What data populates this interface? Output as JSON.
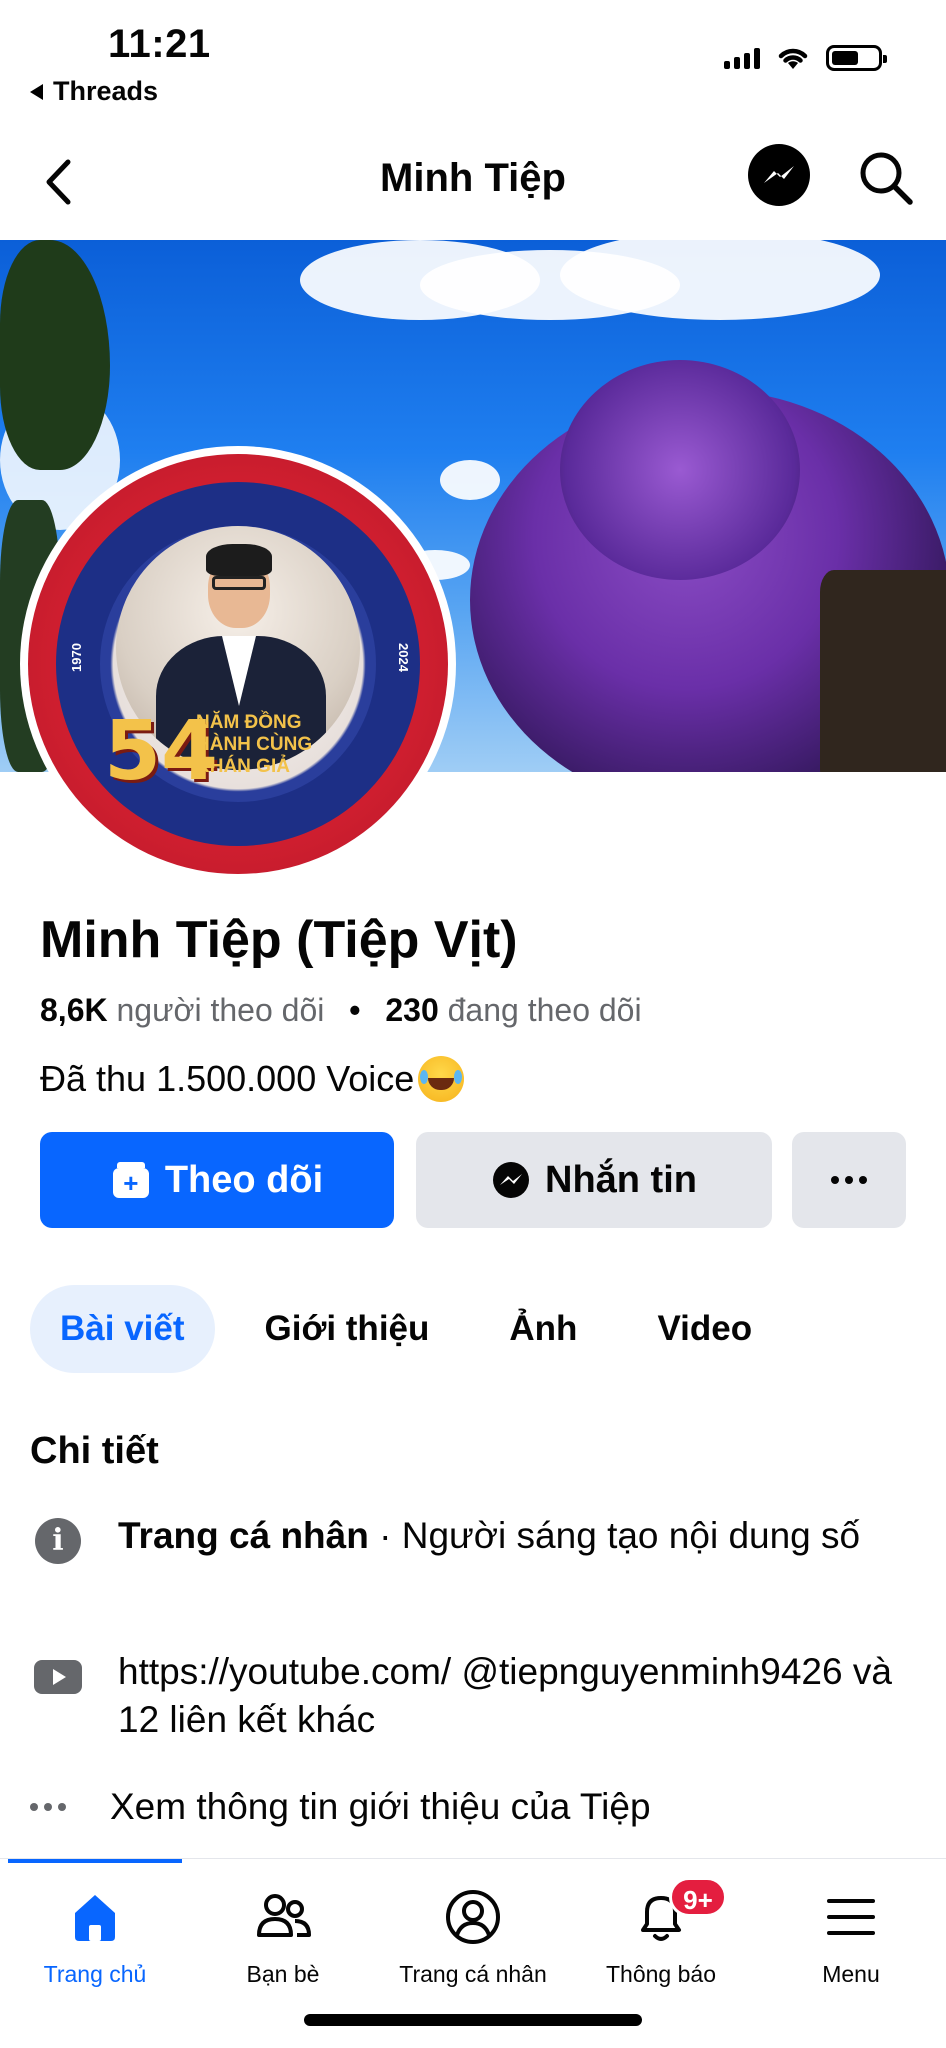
{
  "status_bar": {
    "time": "11:21",
    "back_app": "Threads"
  },
  "header": {
    "title": "Minh Tiệp"
  },
  "avatar": {
    "badge_number": "54",
    "badge_text": "NĂM ĐỒNG HÀNH CÙNG KHÁN GIẢ",
    "year_start": "1970",
    "year_end": "2024"
  },
  "profile": {
    "name": "Minh Tiệp (Tiệp Vịt)",
    "followers_count": "8,6K",
    "followers_label": "người theo dõi",
    "following_count": "230",
    "following_label": "đang theo dõi",
    "bio": "Đã thu 1.500.000 Voice"
  },
  "actions": {
    "follow_label": "Theo dõi",
    "message_label": "Nhắn tin"
  },
  "tabs": [
    {
      "label": "Bài viết",
      "active": true
    },
    {
      "label": "Giới thiệu",
      "active": false
    },
    {
      "label": "Ảnh",
      "active": false
    },
    {
      "label": "Video",
      "active": false
    }
  ],
  "details": {
    "title": "Chi tiết",
    "page_type_label": "Trang cá nhân",
    "page_type_value": " · Người sáng tạo nội dung số",
    "link_text": "https://youtube.com/ @tiepnguyenminh9426 và 12 liên kết khác",
    "see_more": "Xem thông tin giới thiệu của Tiệp"
  },
  "bottom_nav": [
    {
      "label": "Trang chủ",
      "icon": "home-icon",
      "active": true
    },
    {
      "label": "Bạn bè",
      "icon": "friends-icon",
      "active": false
    },
    {
      "label": "Trang cá nhân",
      "icon": "profile-icon",
      "active": false
    },
    {
      "label": "Thông báo",
      "icon": "bell-icon",
      "active": false,
      "badge": "9+"
    },
    {
      "label": "Menu",
      "icon": "menu-icon",
      "active": false
    }
  ],
  "colors": {
    "accent": "#0866ff",
    "button_gray": "#e4e6eb",
    "badge_red": "#e41e3f",
    "tab_active_bg": "#e7f0fd"
  }
}
